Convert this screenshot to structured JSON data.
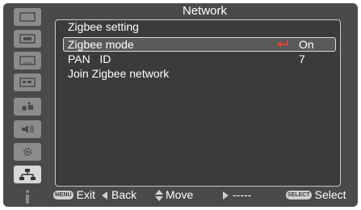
{
  "header": {
    "title": "Network"
  },
  "sidebar": {
    "items": [
      {
        "icon": "display-icon",
        "active": false
      },
      {
        "icon": "picture-adjust-icon",
        "active": false
      },
      {
        "icon": "screen-icon",
        "active": false
      },
      {
        "icon": "setting-icon",
        "active": false
      },
      {
        "icon": "expand-icon",
        "active": false
      },
      {
        "icon": "sound-icon",
        "active": false
      },
      {
        "icon": "settings-gear-icon",
        "active": false
      },
      {
        "icon": "network-icon",
        "active": true
      },
      {
        "icon": "info-icon",
        "active": false
      }
    ]
  },
  "panel": {
    "title": "Zigbee setting",
    "rows": [
      {
        "label": "Zigbee mode",
        "value": "On",
        "selected": true
      },
      {
        "label": "PAN   ID",
        "value": "7",
        "selected": false
      },
      {
        "label": "Join Zigbee network",
        "value": "",
        "selected": false
      }
    ]
  },
  "footer": {
    "exit_glyph": "MENU",
    "exit_label": "Exit",
    "back_label": "Back",
    "move_label": "Move",
    "next_label": "-----",
    "select_glyph": "SELECT",
    "select_label": "Select"
  },
  "colors": {
    "frame": "#4a4a4a",
    "panel": "#3b3b3b",
    "accent": "#e8403a",
    "tile": "#8b8b8b",
    "tile_active": "#d8d8d8"
  }
}
